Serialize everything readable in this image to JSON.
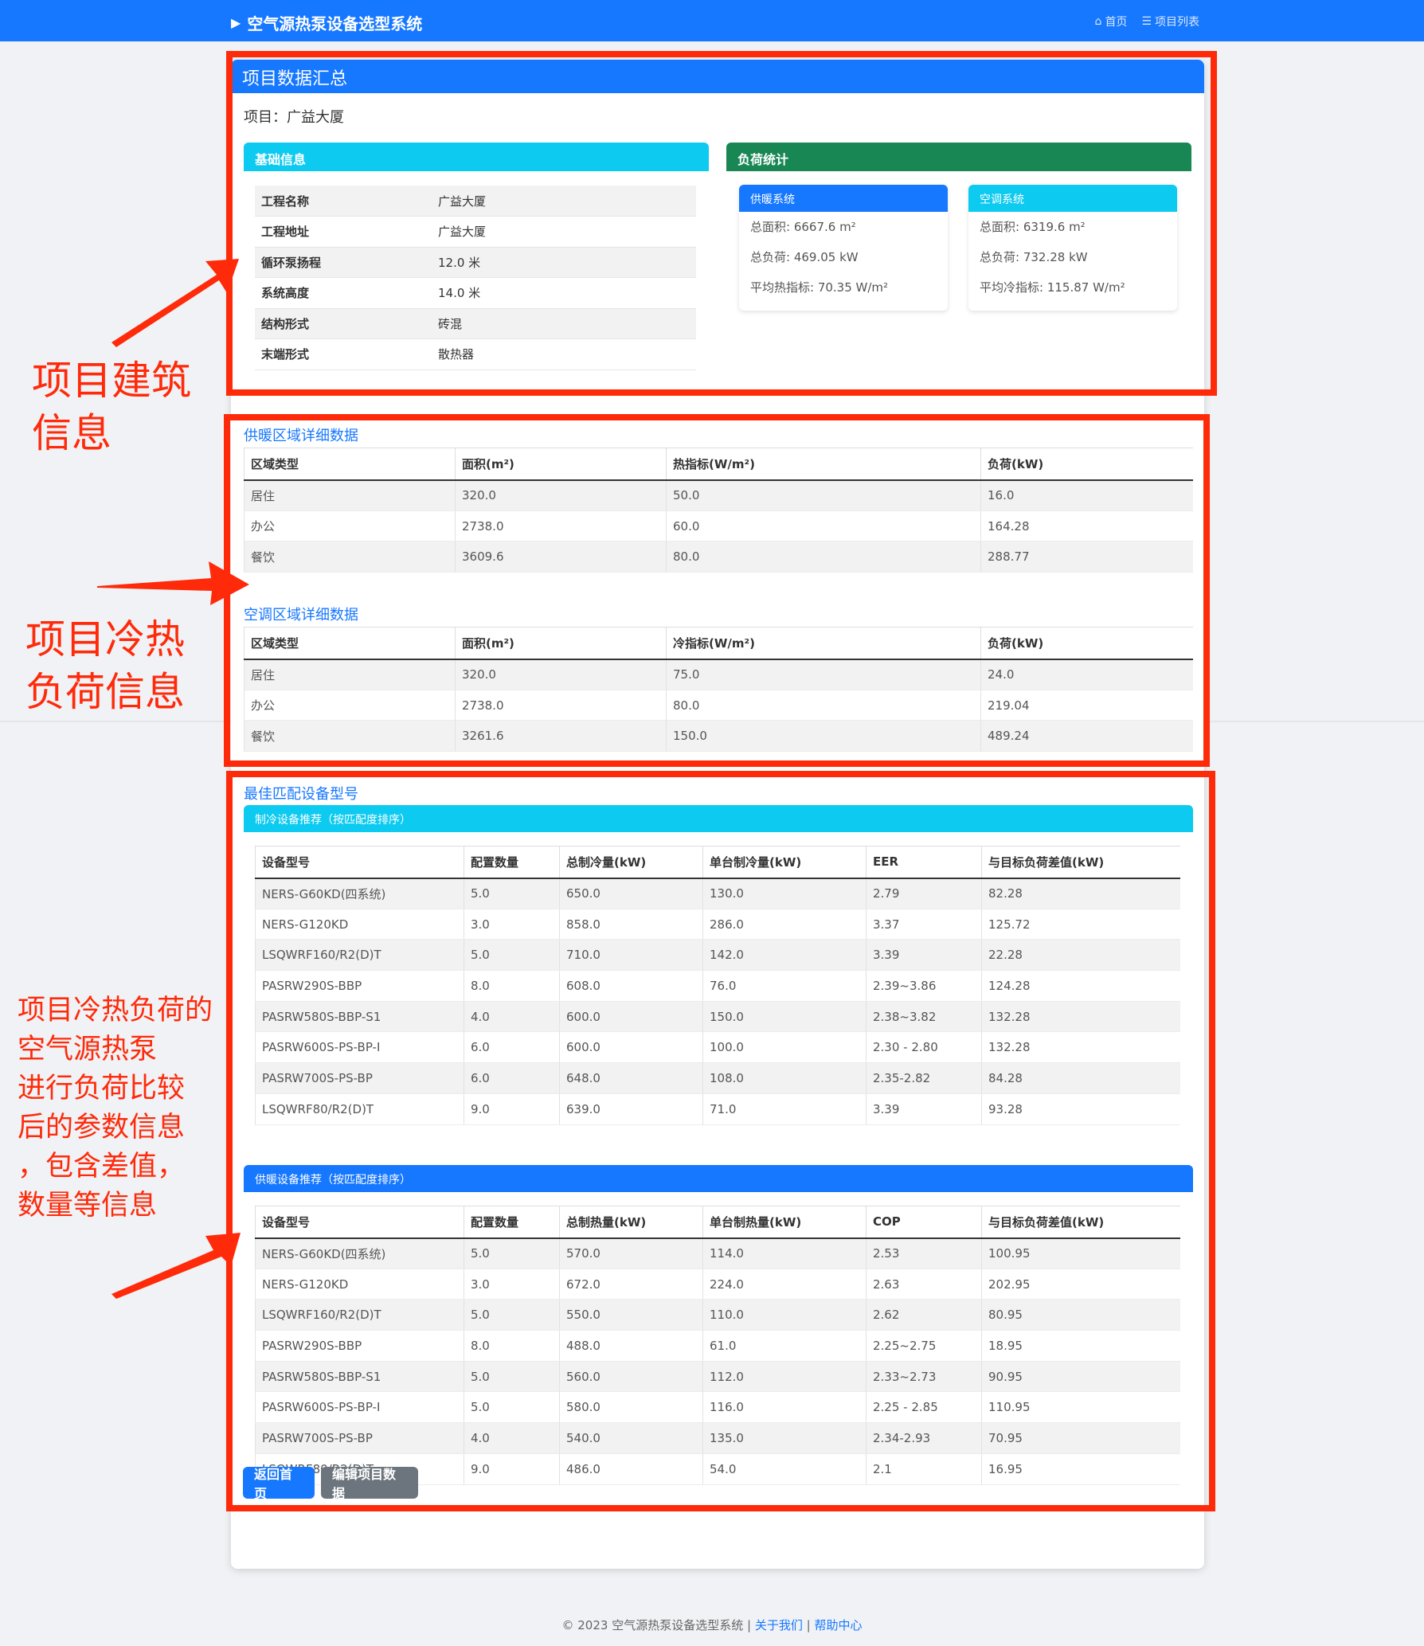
{
  "header": {
    "brand": "空气源热泵设备选型系统",
    "nav": [
      "首页",
      "项目列表"
    ]
  },
  "card": {
    "title": "项目数据汇总",
    "project_label": "项目：广益大厦"
  },
  "basic_info": {
    "title": "基础信息",
    "rows": [
      [
        "工程名称",
        "广益大厦"
      ],
      [
        "工程地址",
        "广益大厦"
      ],
      [
        "循环泵扬程",
        "12.0 米"
      ],
      [
        "系统高度",
        "14.0 米"
      ],
      [
        "结构形式",
        "砖混"
      ],
      [
        "末端形式",
        "散热器"
      ]
    ]
  },
  "load_stats": {
    "title": "负荷统计",
    "heating": {
      "title": "供暖系统",
      "lines": [
        "总面积: 6667.6 m²",
        "总负荷: 469.05 kW",
        "平均热指标: 70.35 W/m²"
      ]
    },
    "cooling": {
      "title": "空调系统",
      "lines": [
        "总面积: 6319.6 m²",
        "总负荷: 732.28 kW",
        "平均冷指标: 115.87 W/m²"
      ]
    }
  },
  "heating_zones": {
    "title": "供暖区域详细数据",
    "headers": [
      "区域类型",
      "面积(m²)",
      "热指标(W/m²)",
      "负荷(kW)"
    ],
    "rows": [
      [
        "居住",
        "320.0",
        "50.0",
        "16.0"
      ],
      [
        "办公",
        "2738.0",
        "60.0",
        "164.28"
      ],
      [
        "餐饮",
        "3609.6",
        "80.0",
        "288.77"
      ]
    ]
  },
  "cooling_zones": {
    "title": "空调区域详细数据",
    "headers": [
      "区域类型",
      "面积(m²)",
      "冷指标(W/m²)",
      "负荷(kW)"
    ],
    "rows": [
      [
        "居住",
        "320.0",
        "75.0",
        "24.0"
      ],
      [
        "办公",
        "2738.0",
        "80.0",
        "219.04"
      ],
      [
        "餐饮",
        "3261.6",
        "150.0",
        "489.24"
      ]
    ]
  },
  "best_match": {
    "title": "最佳匹配设备型号",
    "cooling": {
      "title": "制冷设备推荐（按匹配度排序）",
      "headers": [
        "设备型号",
        "配置数量",
        "总制冷量(kW)",
        "单台制冷量(kW)",
        "EER",
        "与目标负荷差值(kW)"
      ],
      "rows": [
        [
          "NERS-G60KD(四系统)",
          "5.0",
          "650.0",
          "130.0",
          "2.79",
          "82.28"
        ],
        [
          "NERS-G120KD",
          "3.0",
          "858.0",
          "286.0",
          "3.37",
          "125.72"
        ],
        [
          "LSQWRF160/R2(D)T",
          "5.0",
          "710.0",
          "142.0",
          "3.39",
          "22.28"
        ],
        [
          "PASRW290S-BBP",
          "8.0",
          "608.0",
          "76.0",
          "2.39~3.86",
          "124.28"
        ],
        [
          "PASRW580S-BBP-S1",
          "4.0",
          "600.0",
          "150.0",
          "2.38~3.82",
          "132.28"
        ],
        [
          "PASRW600S-PS-BP-I",
          "6.0",
          "600.0",
          "100.0",
          "2.30 - 2.80",
          "132.28"
        ],
        [
          "PASRW700S-PS-BP",
          "6.0",
          "648.0",
          "108.0",
          "2.35-2.82",
          "84.28"
        ],
        [
          "LSQWRF80/R2(D)T",
          "9.0",
          "639.0",
          "71.0",
          "3.39",
          "93.28"
        ]
      ]
    },
    "heating": {
      "title": "供暖设备推荐（按匹配度排序）",
      "headers": [
        "设备型号",
        "配置数量",
        "总制热量(kW)",
        "单台制热量(kW)",
        "COP",
        "与目标负荷差值(kW)"
      ],
      "rows": [
        [
          "NERS-G60KD(四系统)",
          "5.0",
          "570.0",
          "114.0",
          "2.53",
          "100.95"
        ],
        [
          "NERS-G120KD",
          "3.0",
          "672.0",
          "224.0",
          "2.63",
          "202.95"
        ],
        [
          "LSQWRF160/R2(D)T",
          "5.0",
          "550.0",
          "110.0",
          "2.62",
          "80.95"
        ],
        [
          "PASRW290S-BBP",
          "8.0",
          "488.0",
          "61.0",
          "2.25~2.75",
          "18.95"
        ],
        [
          "PASRW580S-BBP-S1",
          "5.0",
          "560.0",
          "112.0",
          "2.33~2.73",
          "90.95"
        ],
        [
          "PASRW600S-PS-BP-I",
          "5.0",
          "580.0",
          "116.0",
          "2.25 - 2.85",
          "110.95"
        ],
        [
          "PASRW700S-PS-BP",
          "4.0",
          "540.0",
          "135.0",
          "2.34-2.93",
          "70.95"
        ],
        [
          "LSQWRF80/R2(D)T",
          "9.0",
          "486.0",
          "54.0",
          "2.1",
          "16.95"
        ]
      ]
    }
  },
  "buttons": {
    "home": "返回首页",
    "edit": "编辑项目数据"
  },
  "footer": {
    "text": "© 2023 空气源热泵设备选型系统 |",
    "about": "关于我们",
    "help": "帮助中心",
    "sep": "|"
  },
  "annotations": {
    "a1": "项目建筑\n信息",
    "a2": "项目冷热\n负荷信息",
    "a3": "项目冷热负荷的\n空气源热泵\n进行负荷比较\n后的参数信息\n，包含差值，\n数量等信息"
  },
  "colors": {
    "primary": "#1677ff",
    "info": "#0dcaf0",
    "success": "#198754",
    "secondary": "#6c757d",
    "annotation": "#ff2a0a"
  }
}
